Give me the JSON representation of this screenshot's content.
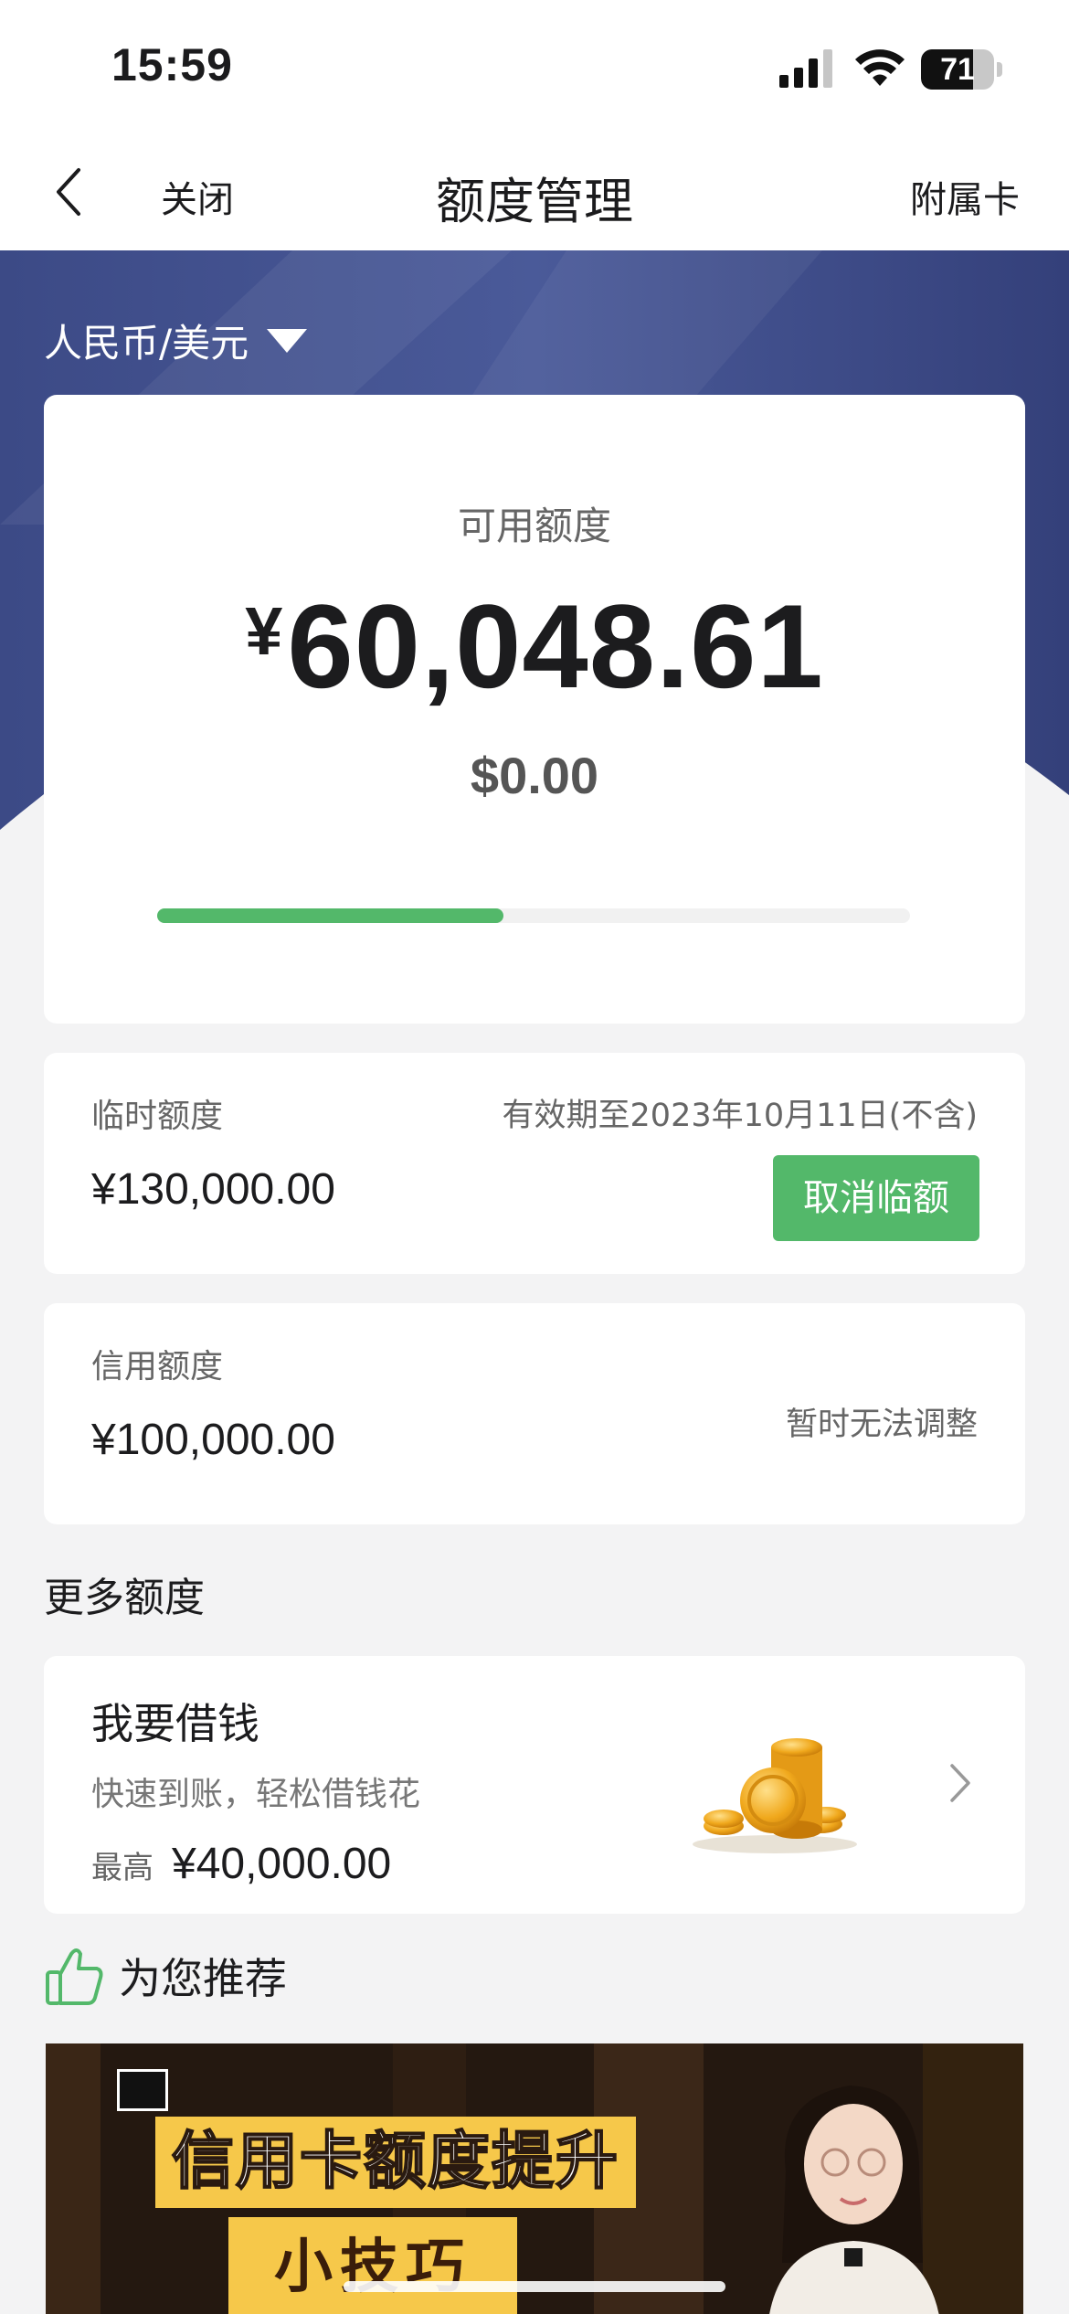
{
  "status_bar": {
    "time": "15:59",
    "battery_level": "71",
    "battery_fraction": 0.71
  },
  "nav": {
    "close_label": "关闭",
    "title": "额度管理",
    "right_label": "附属卡"
  },
  "currency_selector": {
    "value": "人民币/美元"
  },
  "available_credit": {
    "label": "可用额度",
    "currency_symbol": "¥",
    "amount": "60,048.61",
    "usd_amount": "$0.00",
    "usage_fraction": 0.46,
    "accent_color": "#53b86a"
  },
  "temporary_credit": {
    "label": "临时额度",
    "amount": "¥130,000.00",
    "validity": "有效期至2023年10月11日(不含)",
    "cancel_button": "取消临额"
  },
  "credit_limit": {
    "label": "信用额度",
    "amount": "¥100,000.00",
    "note": "暂时无法调整"
  },
  "more_credit": {
    "heading": "更多额度",
    "loan": {
      "title": "我要借钱",
      "subtitle": "快速到账，轻松借钱花",
      "max_label": "最高",
      "max_value": "¥40,000.00",
      "icon": "gold-coins-icon"
    }
  },
  "recommend": {
    "heading": "为您推荐",
    "icon": "thumbs-up-icon",
    "banner": {
      "title": "信用卡额度提升",
      "subtitle": "小技巧"
    }
  }
}
